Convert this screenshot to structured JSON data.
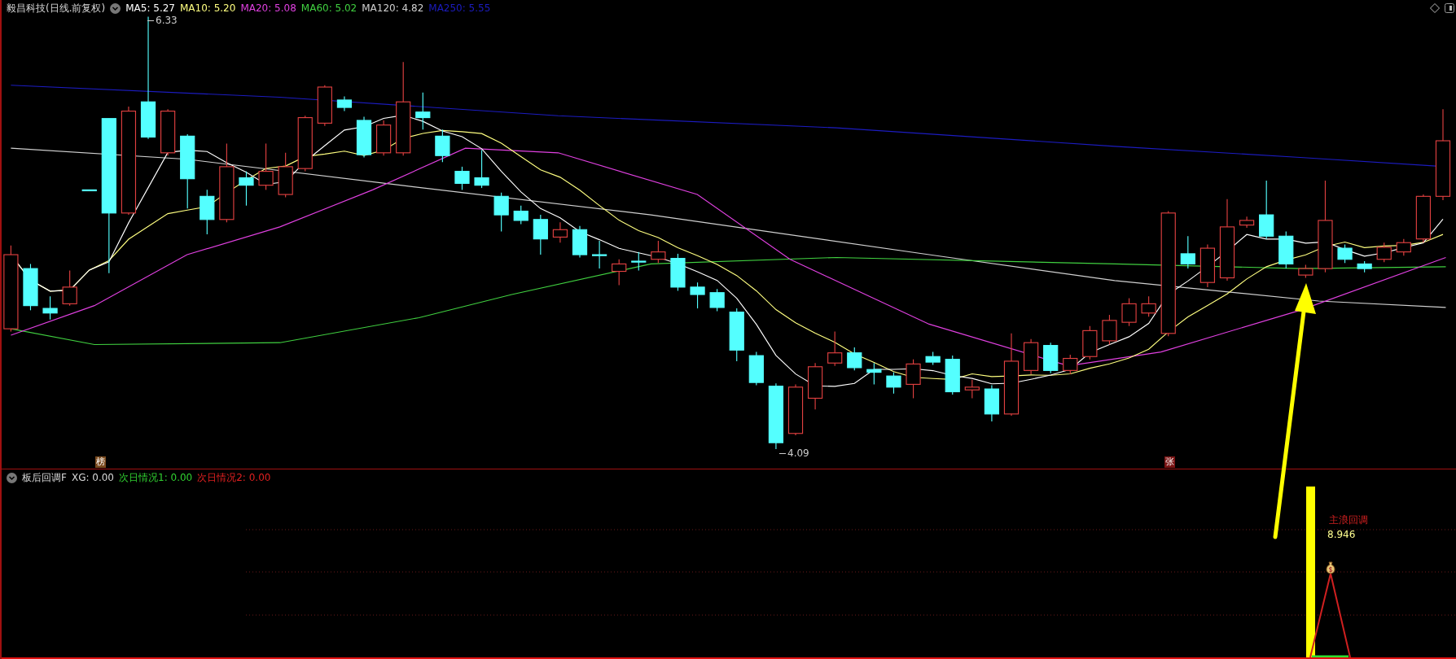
{
  "title": "毅昌科技(日线.前复权)",
  "indicators": [
    {
      "label": "MA5: 5.27",
      "color": "#ffffff"
    },
    {
      "label": "MA10: 5.20",
      "color": "#ffff80"
    },
    {
      "label": "MA20: 5.08",
      "color": "#e040e0"
    },
    {
      "label": "MA60: 5.02",
      "color": "#40d040"
    },
    {
      "label": "MA120: 4.82",
      "color": "#d0d0d0"
    },
    {
      "label": "MA250: 5.55",
      "color": "#1c1cc0"
    }
  ],
  "price_labels": {
    "high": "6.33",
    "low": "4.09"
  },
  "markers": [
    {
      "text": "榜",
      "color": "#7a4a1e"
    },
    {
      "text": "张",
      "color": "#7a1414"
    }
  ],
  "sub_panel": {
    "title": "板后回调F",
    "indicators": [
      {
        "label": "XG: 0.00",
        "color": "#d8d8d8"
      },
      {
        "label": "次日情况1: 0.00",
        "color": "#30d030"
      },
      {
        "label": "次日情况2: 0.00",
        "color": "#e02020"
      }
    ],
    "signal": {
      "label": "主浪回调",
      "value": "8.946"
    }
  }
}
